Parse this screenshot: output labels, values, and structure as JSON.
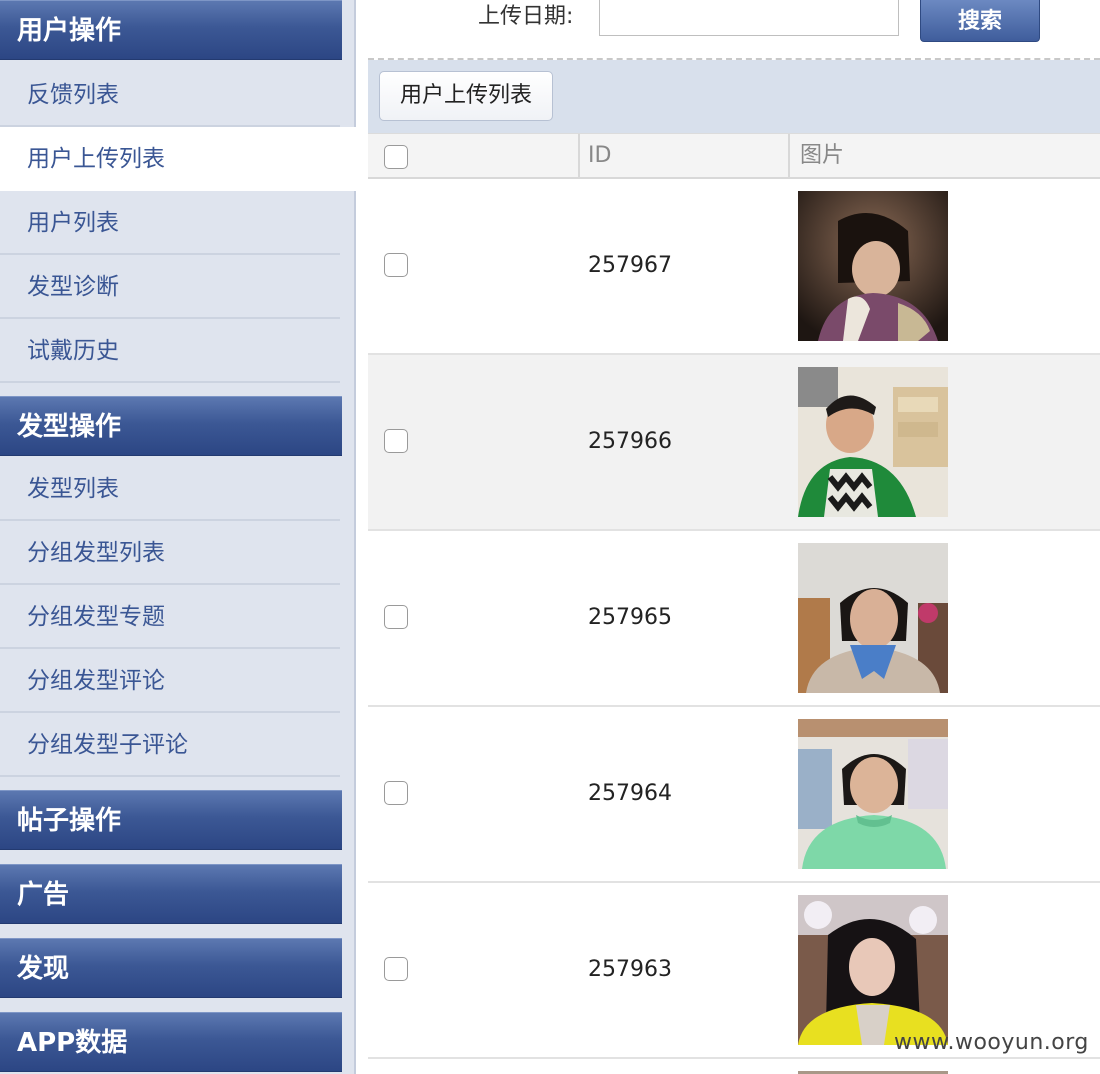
{
  "sidebar": {
    "sections": [
      {
        "title": "用户操作",
        "items": [
          "反馈列表",
          "用户上传列表",
          "用户列表",
          "发型诊断",
          "试戴历史"
        ],
        "active_item": "用户上传列表"
      },
      {
        "title": "发型操作",
        "items": [
          "发型列表",
          "分组发型列表",
          "分组发型专题",
          "分组发型评论",
          "分组发型子评论"
        ]
      },
      {
        "title": "帖子操作"
      },
      {
        "title": "广告"
      },
      {
        "title": "发现"
      },
      {
        "title": "APP数据"
      }
    ]
  },
  "search": {
    "label": "上传日期:",
    "value": "",
    "button_label": "搜索"
  },
  "tabs": {
    "active_label": "用户上传列表"
  },
  "table": {
    "columns": [
      "",
      "ID",
      "图片"
    ],
    "rows": [
      {
        "id": "257967",
        "photo": "photo-woman-dark-room"
      },
      {
        "id": "257966",
        "photo": "photo-boy-green-jacket"
      },
      {
        "id": "257965",
        "photo": "photo-woman-blue-scarf"
      },
      {
        "id": "257964",
        "photo": "photo-girl-green-sweater"
      },
      {
        "id": "257963",
        "photo": "photo-woman-yellow-jacket"
      }
    ]
  },
  "watermark": "www.wooyun.org",
  "colors": {
    "section_header": "#3c5895",
    "nav_text": "#3a5694",
    "sidebar_bg": "#dfe4ee",
    "tab_strip_bg": "#d8e0ec",
    "row_alt_bg": "#f2f2f2"
  }
}
